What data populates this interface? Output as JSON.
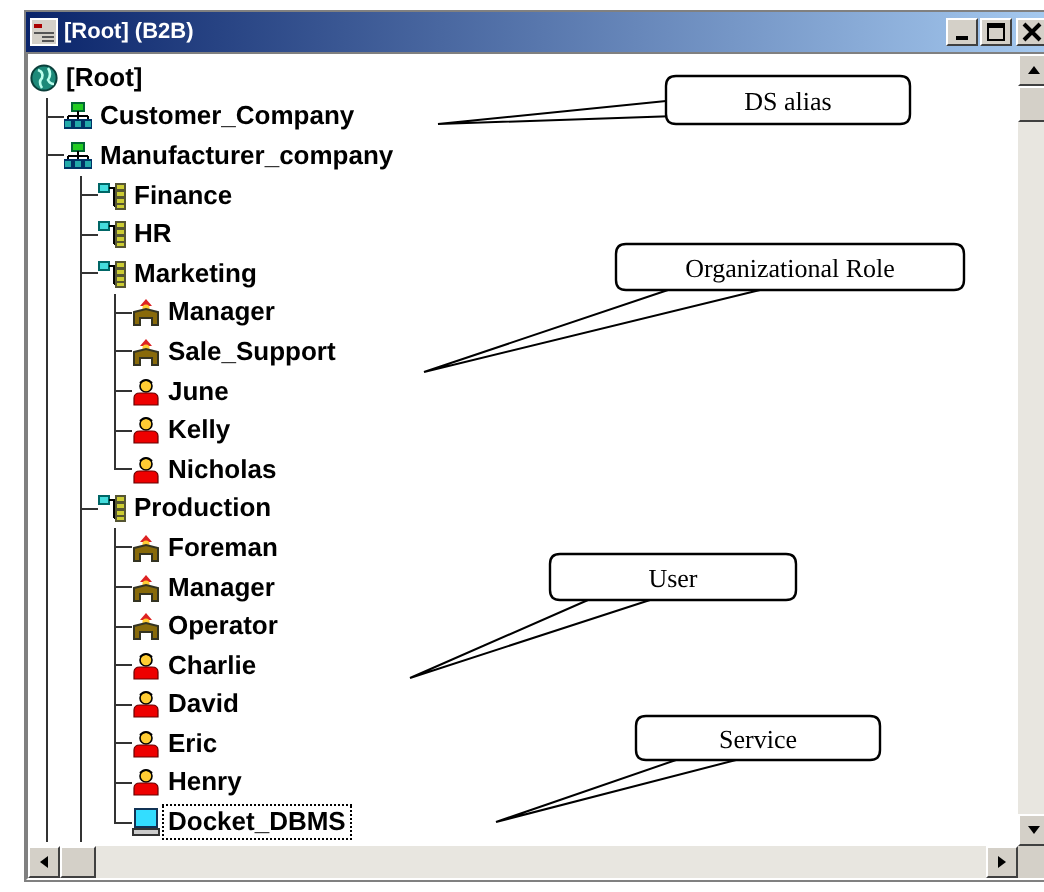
{
  "window": {
    "title": "[Root] (B2B)"
  },
  "tree": [
    {
      "label": "[Root]",
      "kind": "root",
      "selected": false,
      "children": [
        {
          "label": "Customer_Company",
          "kind": "alias",
          "selected": false
        },
        {
          "label": "Manufacturer_company",
          "kind": "alias",
          "selected": false,
          "children": [
            {
              "label": "Finance",
              "kind": "unit",
              "selected": false
            },
            {
              "label": "HR",
              "kind": "unit",
              "selected": false
            },
            {
              "label": "Marketing",
              "kind": "unit",
              "selected": false,
              "children": [
                {
                  "label": "Manager",
                  "kind": "role",
                  "selected": false
                },
                {
                  "label": "Sale_Support",
                  "kind": "role",
                  "selected": false
                },
                {
                  "label": "June",
                  "kind": "user",
                  "selected": false
                },
                {
                  "label": "Kelly",
                  "kind": "user",
                  "selected": false
                },
                {
                  "label": "Nicholas",
                  "kind": "user",
                  "selected": false
                }
              ]
            },
            {
              "label": "Production",
              "kind": "unit",
              "selected": false,
              "children": [
                {
                  "label": "Foreman",
                  "kind": "role",
                  "selected": false
                },
                {
                  "label": "Manager",
                  "kind": "role",
                  "selected": false
                },
                {
                  "label": "Operator",
                  "kind": "role",
                  "selected": false
                },
                {
                  "label": "Charlie",
                  "kind": "user",
                  "selected": false
                },
                {
                  "label": "David",
                  "kind": "user",
                  "selected": false
                },
                {
                  "label": "Eric",
                  "kind": "user",
                  "selected": false
                },
                {
                  "label": "Henry",
                  "kind": "user",
                  "selected": false
                },
                {
                  "label": "Docket_DBMS",
                  "kind": "service",
                  "selected": true
                }
              ]
            }
          ]
        }
      ]
    }
  ],
  "callouts": [
    {
      "label": "DS alias"
    },
    {
      "label": "Organizational Role"
    },
    {
      "label": "User"
    },
    {
      "label": "Service"
    }
  ]
}
